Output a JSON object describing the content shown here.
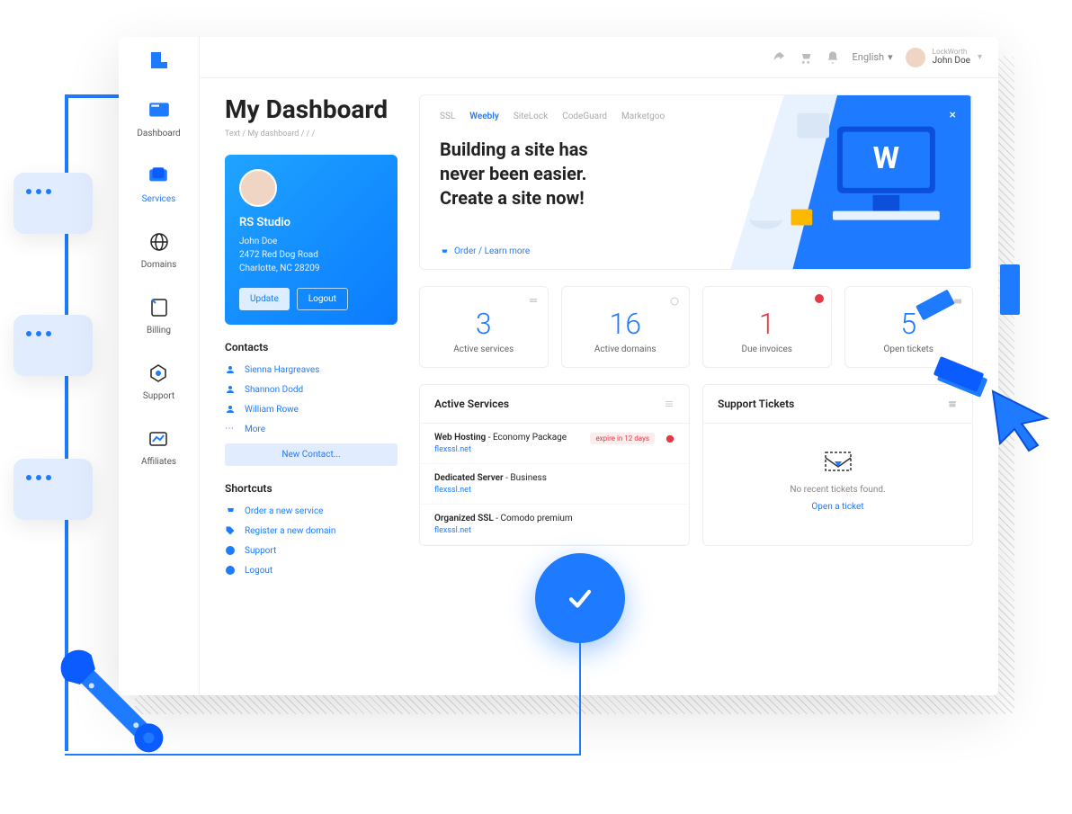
{
  "header": {
    "language": "English",
    "user_company": "LockWorth",
    "user_name": "John Doe"
  },
  "sidebar": {
    "items": [
      {
        "label": "Dashboard"
      },
      {
        "label": "Services"
      },
      {
        "label": "Domains"
      },
      {
        "label": "Billing"
      },
      {
        "label": "Support"
      },
      {
        "label": "Affiliates"
      }
    ]
  },
  "page": {
    "title": "My Dashboard",
    "breadcrumb_1": "Text",
    "breadcrumb_2": "My dashboard"
  },
  "profile": {
    "name": "RS Studio",
    "user": "John Doe",
    "address1": "2472 Red Dog Road",
    "address2": "Charlotte, NC 28209",
    "btn_update": "Update",
    "btn_logout": "Logout"
  },
  "contacts": {
    "title": "Contacts",
    "items": [
      "Sienna Hargreaves",
      "Shannon Dodd",
      "William Rowe"
    ],
    "more": "More",
    "btn_new": "New Contact..."
  },
  "shortcuts": {
    "title": "Shortcuts",
    "items": [
      "Order a new service",
      "Register a new domain",
      "Support",
      "Logout"
    ]
  },
  "banner": {
    "tabs": [
      "SSL",
      "Weebly",
      "SiteLock",
      "CodeGuard",
      "Marketgoo"
    ],
    "headline": "Building a site has never been easier. Create a site now!",
    "link": "Order / Learn more"
  },
  "stats": [
    {
      "value": "3",
      "label": "Active services",
      "color": "normal"
    },
    {
      "value": "16",
      "label": "Active domains",
      "color": "normal"
    },
    {
      "value": "1",
      "label": "Due invoices",
      "color": "danger",
      "badge": true
    },
    {
      "value": "5",
      "label": "Open tickets",
      "color": "normal"
    }
  ],
  "active_services": {
    "title": "Active Services",
    "rows": [
      {
        "name": "Web Hosting",
        "plan": " - Economy Package",
        "domain": "flexssl.net",
        "expire": "expire in 12 days"
      },
      {
        "name": "Dedicated Server",
        "plan": " - Business",
        "domain": "flexssl.net"
      },
      {
        "name": "Organized SSL",
        "plan": " - Comodo premium",
        "domain": "flexssl.net"
      }
    ]
  },
  "support_tickets": {
    "title": "Support Tickets",
    "empty_text": "No recent tickets found.",
    "open_link": "Open a ticket"
  }
}
